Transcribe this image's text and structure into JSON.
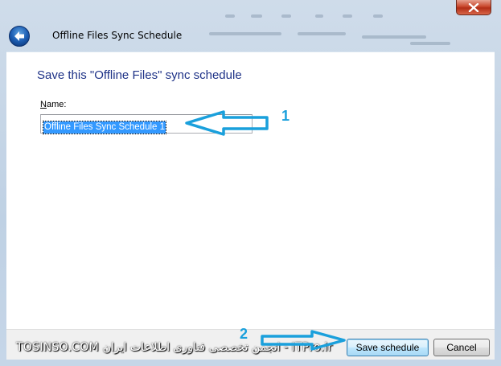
{
  "window": {
    "title": "Offline Files Sync Schedule",
    "close_symbol": "×"
  },
  "page": {
    "instruction": "Save this \"Offline Files\" sync schedule",
    "name_label_mnemonic": "N",
    "name_label_rest": "ame:",
    "name_value": "Offline Files Sync Schedule 1"
  },
  "buttons": {
    "save": "Save schedule",
    "cancel": "Cancel"
  },
  "annotations": {
    "step1": "1",
    "step2": "2"
  },
  "watermark": "TOSINSO.COM انجمن تخصصی فناوری اطلاعات ایران - ITPro.ir",
  "icons": {
    "back": "back-arrow-icon",
    "close": "close-icon",
    "annotation_arrow": "annotation-arrow-icon"
  },
  "colors": {
    "title_blue": "#1e3287",
    "selection": "#3399ff",
    "annotation": "#1aa0dc",
    "close_red": "#c9482d"
  }
}
